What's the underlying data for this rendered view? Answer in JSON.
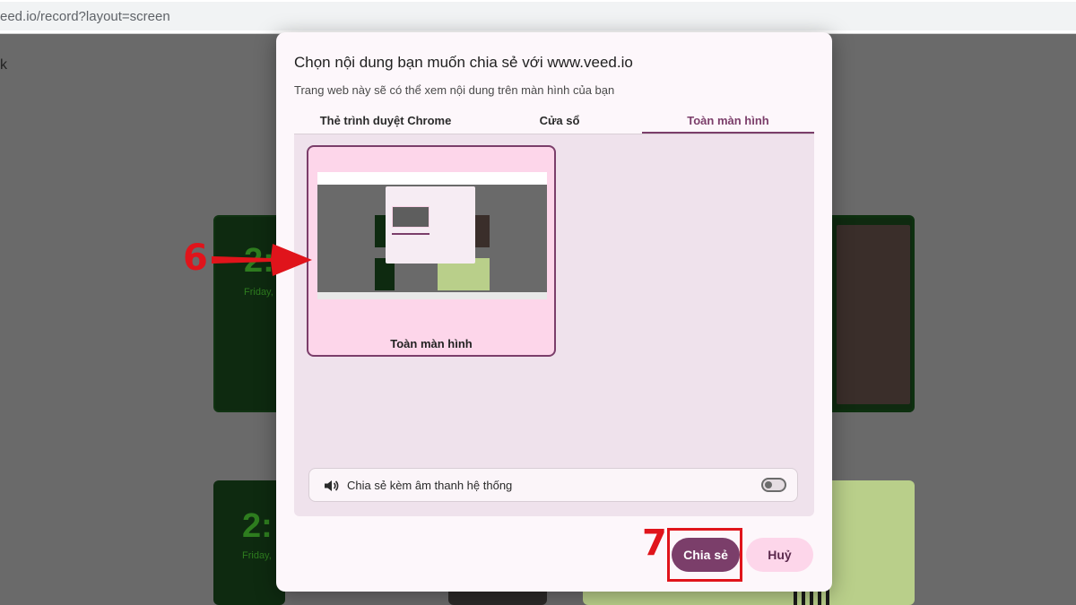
{
  "browser": {
    "url": "eed.io/record?layout=screen"
  },
  "background": {
    "back_glyph": "k",
    "clock_time_1": "2:",
    "clock_date_1": "Friday, I",
    "clock_time_2": "2:",
    "clock_date_2": "Friday,"
  },
  "dialog": {
    "title": "Chọn nội dung bạn muốn chia sẻ với www.veed.io",
    "subtitle": "Trang web này sẽ có thể xem nội dung trên màn hình của bạn",
    "tabs": [
      {
        "label": "Thẻ trình duyệt Chrome",
        "active": false
      },
      {
        "label": "Cửa sổ",
        "active": false
      },
      {
        "label": "Toàn màn hình",
        "active": true
      }
    ],
    "screen_option": {
      "label": "Toàn màn hình",
      "selected": true
    },
    "audio": {
      "label": "Chia sẻ kèm âm thanh hệ thống",
      "enabled": false
    },
    "buttons": {
      "share": "Chia sẻ",
      "cancel": "Huỷ"
    }
  },
  "annotations": {
    "step_6": "6",
    "step_7": "7",
    "color": "#e0141b"
  },
  "colors": {
    "accent": "#7b3e6a",
    "selected_bg": "#fdd6ea",
    "panel_bg": "#efe2ec"
  }
}
